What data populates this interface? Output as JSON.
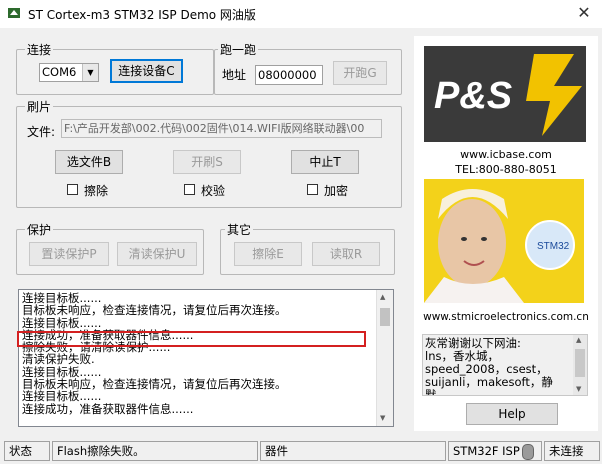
{
  "window": {
    "title": "ST Cortex-m3 STM32  ISP Demo 网油版",
    "close_glyph": "✕"
  },
  "connect": {
    "legend": "连接",
    "port_value": "COM6",
    "connect_button": "连接设备C"
  },
  "run": {
    "legend": "跑一跑",
    "address_label": "地址",
    "address_value": "08000000",
    "run_button": "开跑G"
  },
  "flash": {
    "legend": "刷片",
    "file_label": "文件:",
    "file_path": "F:\\产品开发部\\002.代码\\002固件\\014.WIFI版网络联动器\\00",
    "select_file_button": "选文件B",
    "start_flash_button": "开刷S",
    "abort_button": "中止T",
    "erase_label": "擦除",
    "verify_label": "校验",
    "encrypt_label": "加密"
  },
  "protect": {
    "legend": "保护",
    "read_protect_button": "置读保护P",
    "clear_read_protect_button": "清读保护U"
  },
  "other": {
    "legend": "其它",
    "erase_button": "擦除E",
    "read_button": "读取R"
  },
  "log": {
    "lines": [
      "连接目标板......",
      "目标板未响应，检查连接情况，请复位后再次连接。",
      "连接目标板......",
      "连接成功，准备获取器件信息......",
      "擦除失败，请清除读保护......",
      "清读保护失败.",
      "连接目标板......",
      "目标板未响应，检查连接情况，请复位后再次连接。",
      "连接目标板......",
      "连接成功，准备获取器件信息......"
    ]
  },
  "sidebar": {
    "brand": "P&S",
    "website": "www.icbase.com",
    "tel": "TEL:800-880-8051",
    "photo_badge": "STM32",
    "st_website": "www.stmicroelectronics.com.cn",
    "thanks_text": "灰常谢谢以下网油:\nlns，香水城，speed_2008，csest，suijanli，makesoft，静默......",
    "help_button": "Help"
  },
  "status_bar": {
    "status_label": "状态",
    "status_message": "Flash擦除失败。",
    "device_label": "器件",
    "device_name": "STM32F ISP",
    "connection_state": "未连接"
  },
  "colors": {
    "highlight_box": "#d42020",
    "accent": "#0078d7",
    "sidebar_bg": "#ffffff"
  }
}
